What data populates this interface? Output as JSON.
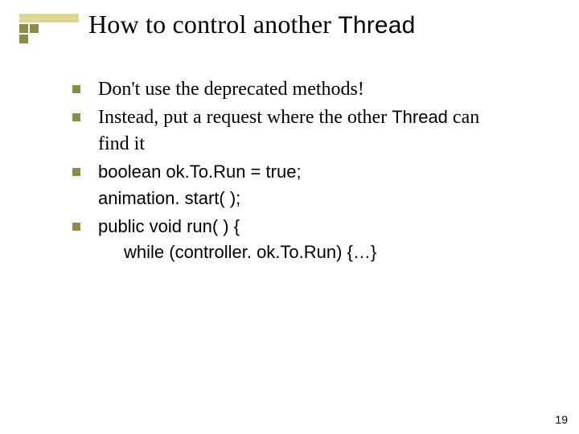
{
  "title": {
    "part1": "How to control another ",
    "part2": "Thread"
  },
  "bullets": [
    {
      "lines": [
        {
          "text": "Don't use the deprecated methods!",
          "sans": false
        }
      ]
    },
    {
      "lines": [
        {
          "prefix": "Instead, put a request where the other ",
          "mono": "Thread",
          "suffix": " can"
        },
        {
          "text": "find it",
          "sans": false
        }
      ]
    },
    {
      "lines": [
        {
          "text": "boolean ok.To.Run = true;",
          "sans": true
        },
        {
          "text": "animation. start( );",
          "sans": true
        }
      ]
    },
    {
      "lines": [
        {
          "text": "public void run( ) {",
          "sans": true
        },
        {
          "text": "while (controller. ok.To.Run) {…}",
          "sans": true,
          "indent": true
        }
      ]
    }
  ],
  "pagenum": "19"
}
